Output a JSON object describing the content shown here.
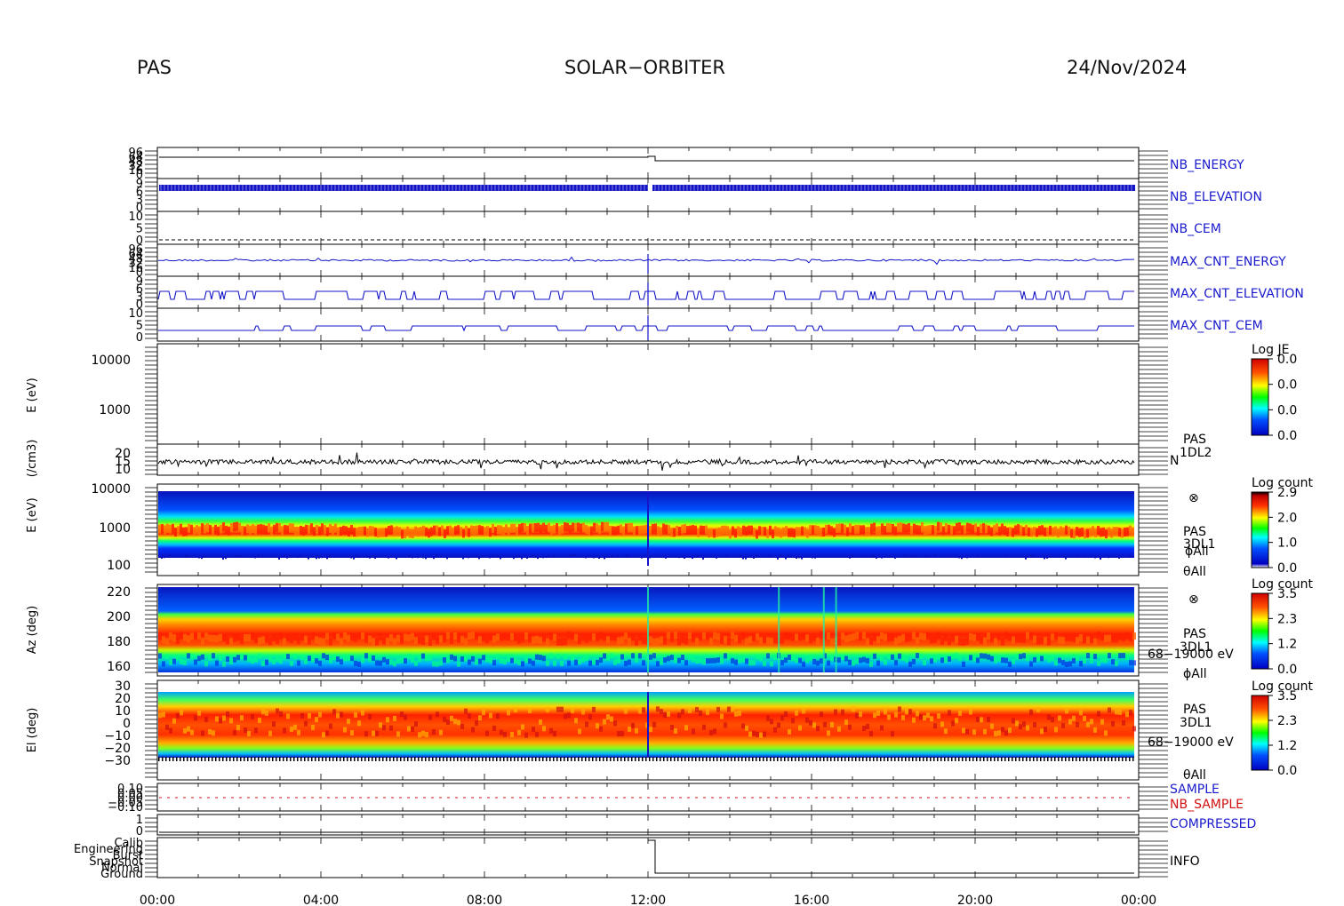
{
  "header": {
    "left": "PAS",
    "center": "SOLAR−ORBITER",
    "right": "24/Nov/2024"
  },
  "x_axis": {
    "ticks": [
      "00:00",
      "04:00",
      "08:00",
      "12:00",
      "16:00",
      "20:00",
      "00:00"
    ]
  },
  "colors": {
    "trace_blue": "#1414c8",
    "trace_black": "#000000",
    "label_blue": "#1a1acc",
    "label_red": "#d01010"
  },
  "chart_data": [
    {
      "type": "line",
      "panel": "nb_energy",
      "label": "NB_ENERGY",
      "tick_labels": [
        "96",
        "64",
        "48",
        "32",
        "16",
        "0"
      ],
      "series": [
        {
          "name": "NB_ENERGY",
          "x": [
            "00:00",
            "12:00",
            "12:05",
            "24:00"
          ],
          "y": [
            96,
            96,
            80,
            80
          ]
        }
      ]
    },
    {
      "type": "line",
      "panel": "nb_elevation",
      "label": "NB_ELEVATION",
      "tick_labels": [
        "9",
        "6",
        "3",
        "0"
      ],
      "series": [
        {
          "name": "NB_ELEVATION",
          "note_values": [
            9,
            6,
            3,
            0
          ]
        }
      ]
    },
    {
      "type": "line",
      "panel": "nb_cem",
      "label": "NB_CEM",
      "tick_labels": [
        "10",
        "5",
        "0"
      ]
    },
    {
      "type": "line",
      "panel": "max_cnt_energy",
      "label": "MAX_CNT_ENERGY",
      "tick_labels": [
        "96",
        "64",
        "48",
        "32",
        "16",
        "0"
      ]
    },
    {
      "type": "line",
      "panel": "max_cnt_elevation",
      "label": "MAX_CNT_ELEVATION",
      "tick_labels": [
        "9",
        "6",
        "3",
        "0"
      ]
    },
    {
      "type": "line",
      "panel": "max_cnt_cem",
      "label": "MAX_CNT_CEM",
      "tick_labels": [
        "10",
        "5",
        "0"
      ]
    },
    {
      "type": "heatmap",
      "panel": "energy_empty",
      "ylabel": "E (eV)",
      "yticks": [
        "10000",
        "1000"
      ],
      "colorbar": {
        "title": "Log JE",
        "ticks": [
          "0.0",
          "0.0",
          "0.0",
          "0.0"
        ]
      }
    },
    {
      "type": "line",
      "panel": "density",
      "ylabel": "(/cm3)",
      "yticks": [
        "20",
        "15",
        "10"
      ],
      "side_labels": [
        "PAS",
        "1DL2",
        "N"
      ],
      "series": [
        {
          "name": "N",
          "x": [
            "00:00",
            "04:00",
            "08:00",
            "12:00",
            "16:00",
            "20:00",
            "24:00"
          ],
          "y": [
            11,
            12,
            12,
            13,
            11,
            12,
            12
          ]
        }
      ]
    },
    {
      "type": "heatmap",
      "panel": "energy_spectrogram",
      "ylabel": "E (eV)",
      "yticks": [
        "10000",
        "1000",
        "100"
      ],
      "yscale": "log",
      "side_labels": [
        "⊗",
        "PAS",
        "3DL1",
        "ϕAll",
        "θAll"
      ],
      "colorbar": {
        "title": "Log count",
        "ticks": [
          "2.9",
          "2.0",
          "1.0",
          "0.0"
        ]
      }
    },
    {
      "type": "heatmap",
      "panel": "azimuth",
      "ylabel": "Az (deg)",
      "yticks": [
        "220",
        "200",
        "180",
        "160"
      ],
      "side_labels": [
        "⊗",
        "PAS",
        "3DL1",
        "68−19000 eV",
        "ϕAll"
      ],
      "colorbar": {
        "title": "Log count",
        "ticks": [
          "3.5",
          "2.3",
          "1.2",
          "0.0"
        ]
      }
    },
    {
      "type": "heatmap",
      "panel": "elevation",
      "ylabel": "El (deg)",
      "yticks": [
        "30",
        "20",
        "10",
        "0",
        "−10",
        "−20",
        "−30"
      ],
      "side_labels": [
        "PAS",
        "3DL1",
        "68−19000 eV",
        "θAll"
      ],
      "colorbar": {
        "title": "Log count",
        "ticks": [
          "3.5",
          "2.3",
          "1.2",
          "0.0"
        ]
      }
    },
    {
      "type": "line",
      "panel": "sample",
      "labels": [
        "SAMPLE",
        "NB_SAMPLE"
      ],
      "tick_labels": [
        "0.10",
        "0.05",
        "0.00",
        "−0.05",
        "−0.10"
      ]
    },
    {
      "type": "line",
      "panel": "compressed",
      "label": "COMPRESSED",
      "tick_labels": [
        "1",
        "0"
      ]
    },
    {
      "type": "line",
      "panel": "info",
      "label": "INFO",
      "tick_labels": [
        "Calib",
        "Engineering",
        "Burst",
        "Snapshot",
        "Normal",
        "Ground"
      ],
      "series": [
        {
          "name": "INFO",
          "x": [
            "00:00",
            "12:00",
            "12:02",
            "24:00"
          ],
          "y": [
            "Calib",
            "Calib",
            "Ground",
            "Ground"
          ]
        }
      ]
    }
  ]
}
